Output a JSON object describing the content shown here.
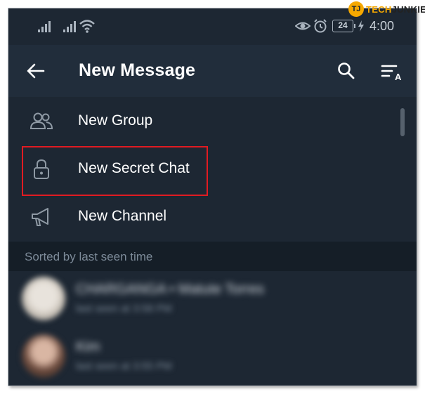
{
  "status_bar": {
    "time": "4:00",
    "battery": "24"
  },
  "app_bar": {
    "title": "New Message",
    "back_icon": "arrow-left-icon",
    "search_icon": "search-icon",
    "sort_icon": "sort-alpha-icon"
  },
  "actions": [
    {
      "label": "New Group",
      "icon": "group-icon"
    },
    {
      "label": "New Secret Chat",
      "icon": "lock-icon"
    },
    {
      "label": "New Channel",
      "icon": "megaphone-icon"
    }
  ],
  "section_header": "Sorted by last seen time",
  "contacts": [
    {
      "name": "CHARGANGA • Matute Torres",
      "status": "last seen at 3:58 PM"
    },
    {
      "name": "Kim",
      "status": "last seen at 3:55 PM"
    }
  ],
  "watermark": {
    "mark": "TJ",
    "prefix": "TECH",
    "suffix": "JUNKIE"
  },
  "colors": {
    "background": "#1d2733",
    "app_bar": "#212d3b",
    "section": "#151e27",
    "highlight_border": "#e11b22",
    "text": "#ffffff",
    "muted_text": "#7d8b99"
  }
}
